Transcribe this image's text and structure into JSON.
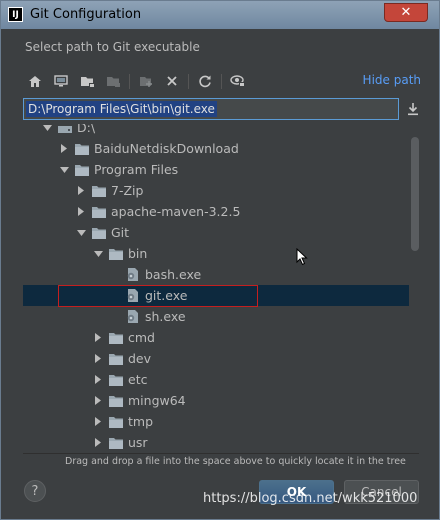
{
  "window": {
    "app_icon_text": "IJ",
    "title": "Git Configuration",
    "close_glyph": "✕"
  },
  "prompt": "Select path to Git executable",
  "toolbar": {
    "icons": [
      "home-icon",
      "desktop-icon",
      "project-icon",
      "module-icon",
      "new-folder-icon",
      "delete-icon",
      "refresh-icon",
      "show-hidden-icon"
    ],
    "hide_path_label": "Hide path"
  },
  "path_field": {
    "value": "D:\\Program Files\\Git\\bin\\git.exe"
  },
  "tree": {
    "items": [
      {
        "label": "D:\\",
        "depth": 0,
        "type": "drive",
        "expanded": true
      },
      {
        "label": "BaiduNetdiskDownload",
        "depth": 1,
        "type": "folder",
        "expanded": false
      },
      {
        "label": "Program Files",
        "depth": 1,
        "type": "folder",
        "expanded": true
      },
      {
        "label": "7-Zip",
        "depth": 2,
        "type": "folder",
        "expanded": false
      },
      {
        "label": "apache-maven-3.2.5",
        "depth": 2,
        "type": "folder",
        "expanded": false
      },
      {
        "label": "Git",
        "depth": 2,
        "type": "folder",
        "expanded": true
      },
      {
        "label": "bin",
        "depth": 3,
        "type": "folder",
        "expanded": true
      },
      {
        "label": "bash.exe",
        "depth": 4,
        "type": "file"
      },
      {
        "label": "git.exe",
        "depth": 4,
        "type": "file",
        "selected": true
      },
      {
        "label": "sh.exe",
        "depth": 4,
        "type": "file"
      },
      {
        "label": "cmd",
        "depth": 3,
        "type": "folder",
        "expanded": false
      },
      {
        "label": "dev",
        "depth": 3,
        "type": "folder",
        "expanded": false
      },
      {
        "label": "etc",
        "depth": 3,
        "type": "folder",
        "expanded": false
      },
      {
        "label": "mingw64",
        "depth": 3,
        "type": "folder",
        "expanded": false
      },
      {
        "label": "tmp",
        "depth": 3,
        "type": "folder",
        "expanded": false
      },
      {
        "label": "usr",
        "depth": 3,
        "type": "folder",
        "expanded": false
      }
    ]
  },
  "hint": "Drag and drop a file into the space above to quickly locate it in the tree",
  "buttons": {
    "help": "?",
    "ok": "OK",
    "cancel": "Cancel"
  },
  "watermark": "https://blog.csdn.net/wkk521000",
  "colors": {
    "background": "#3c3f41",
    "selection": "#0d293e",
    "accent_link": "#589df6",
    "highlight_box": "#c41f1f"
  }
}
